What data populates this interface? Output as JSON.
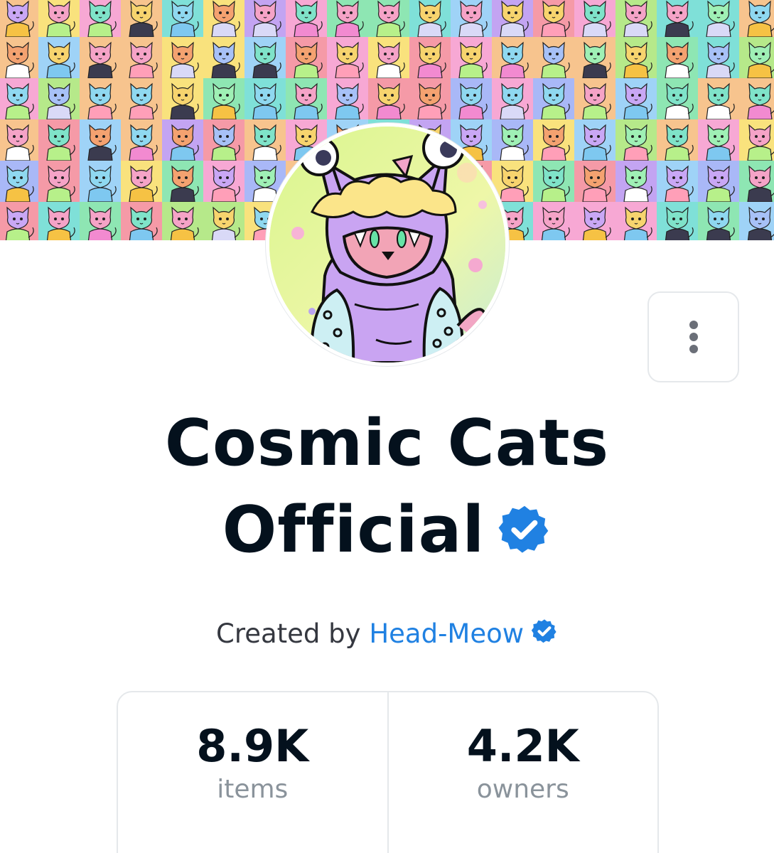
{
  "collection": {
    "name_line1": "Cosmic Cats",
    "name_line2": "Official",
    "verified": true
  },
  "creator": {
    "prefix": "Created by",
    "name": "Head-Meow",
    "verified": true
  },
  "menu": {
    "icon": "more-vertical-icon"
  },
  "stats": [
    {
      "value": "8.9K",
      "label": "items"
    },
    {
      "value": "4.2K",
      "label": "owners"
    }
  ],
  "colors": {
    "title": "#04111d",
    "link": "#2081e2",
    "badge": "#2081e2",
    "muted": "#8a939b",
    "border": "#e5e8eb"
  }
}
